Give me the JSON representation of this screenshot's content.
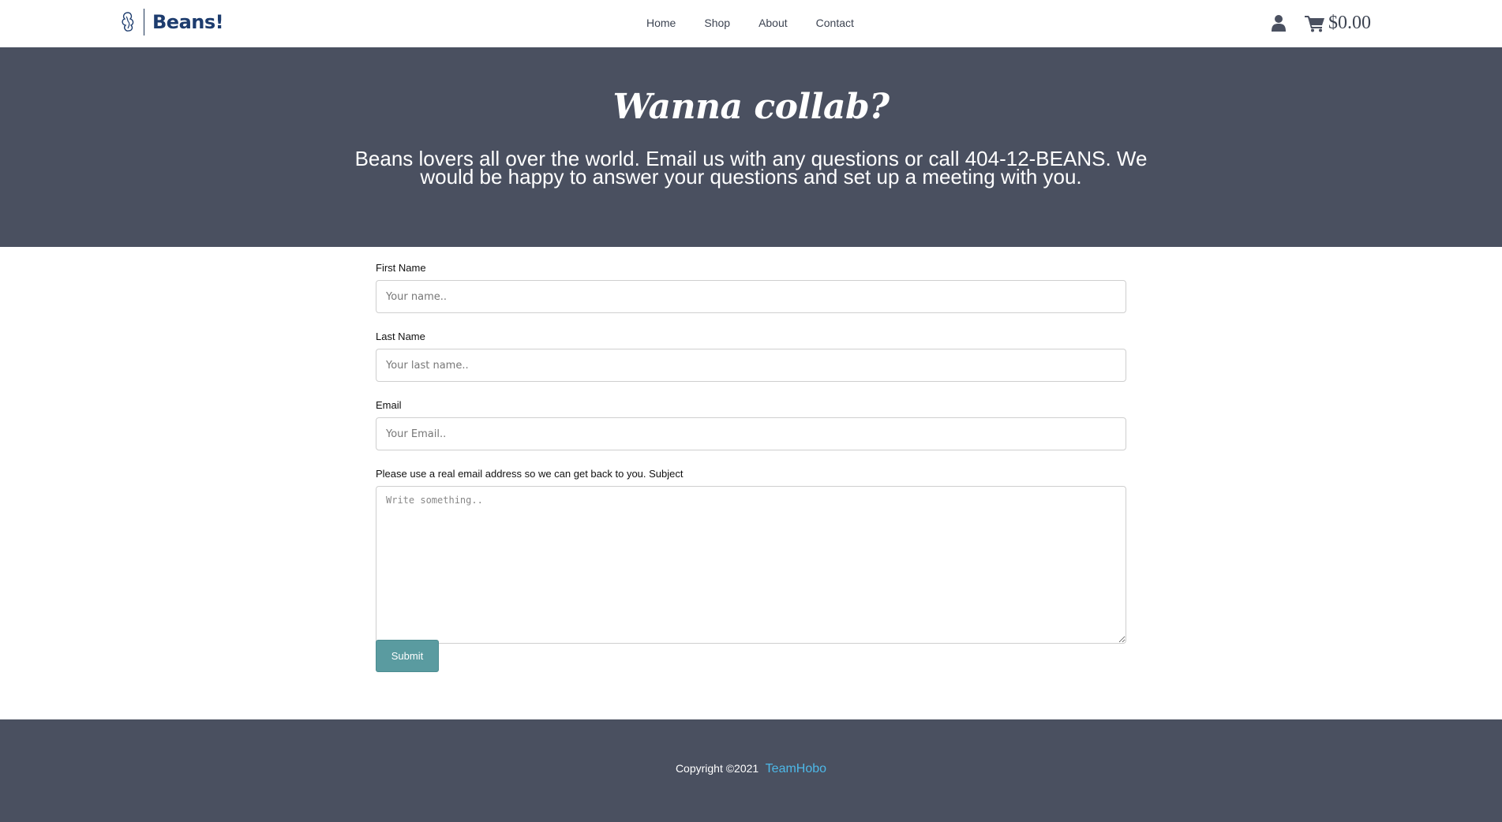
{
  "header": {
    "brand": "Beans!",
    "nav": [
      "Home",
      "Shop",
      "About",
      "Contact"
    ],
    "cart_total": "$0.00"
  },
  "hero": {
    "title": "Wanna collab?",
    "text": "Beans lovers all over the world. Email us with any questions or call 404-12-BEANS. We would be happy to answer your questions and set up a meeting with you."
  },
  "form": {
    "first_name_label": "First Name",
    "first_name_placeholder": "Your name..",
    "last_name_label": "Last Name",
    "last_name_placeholder": "Your last name..",
    "email_label": "Email",
    "email_placeholder": "Your Email..",
    "subject_label": "Please use a real email address so we can get back to you. Subject",
    "subject_placeholder": "Write something..",
    "submit_label": "Submit"
  },
  "footer": {
    "copyright": "Copyright ©2021",
    "team": "TeamHobo"
  },
  "colors": {
    "dark_band": "#4a5060",
    "brand_blue": "#1d3c6e",
    "submit": "#5a9ba0",
    "link": "#4db8e8"
  },
  "icons": [
    "logo-mark-icon",
    "user-icon",
    "cart-icon"
  ]
}
